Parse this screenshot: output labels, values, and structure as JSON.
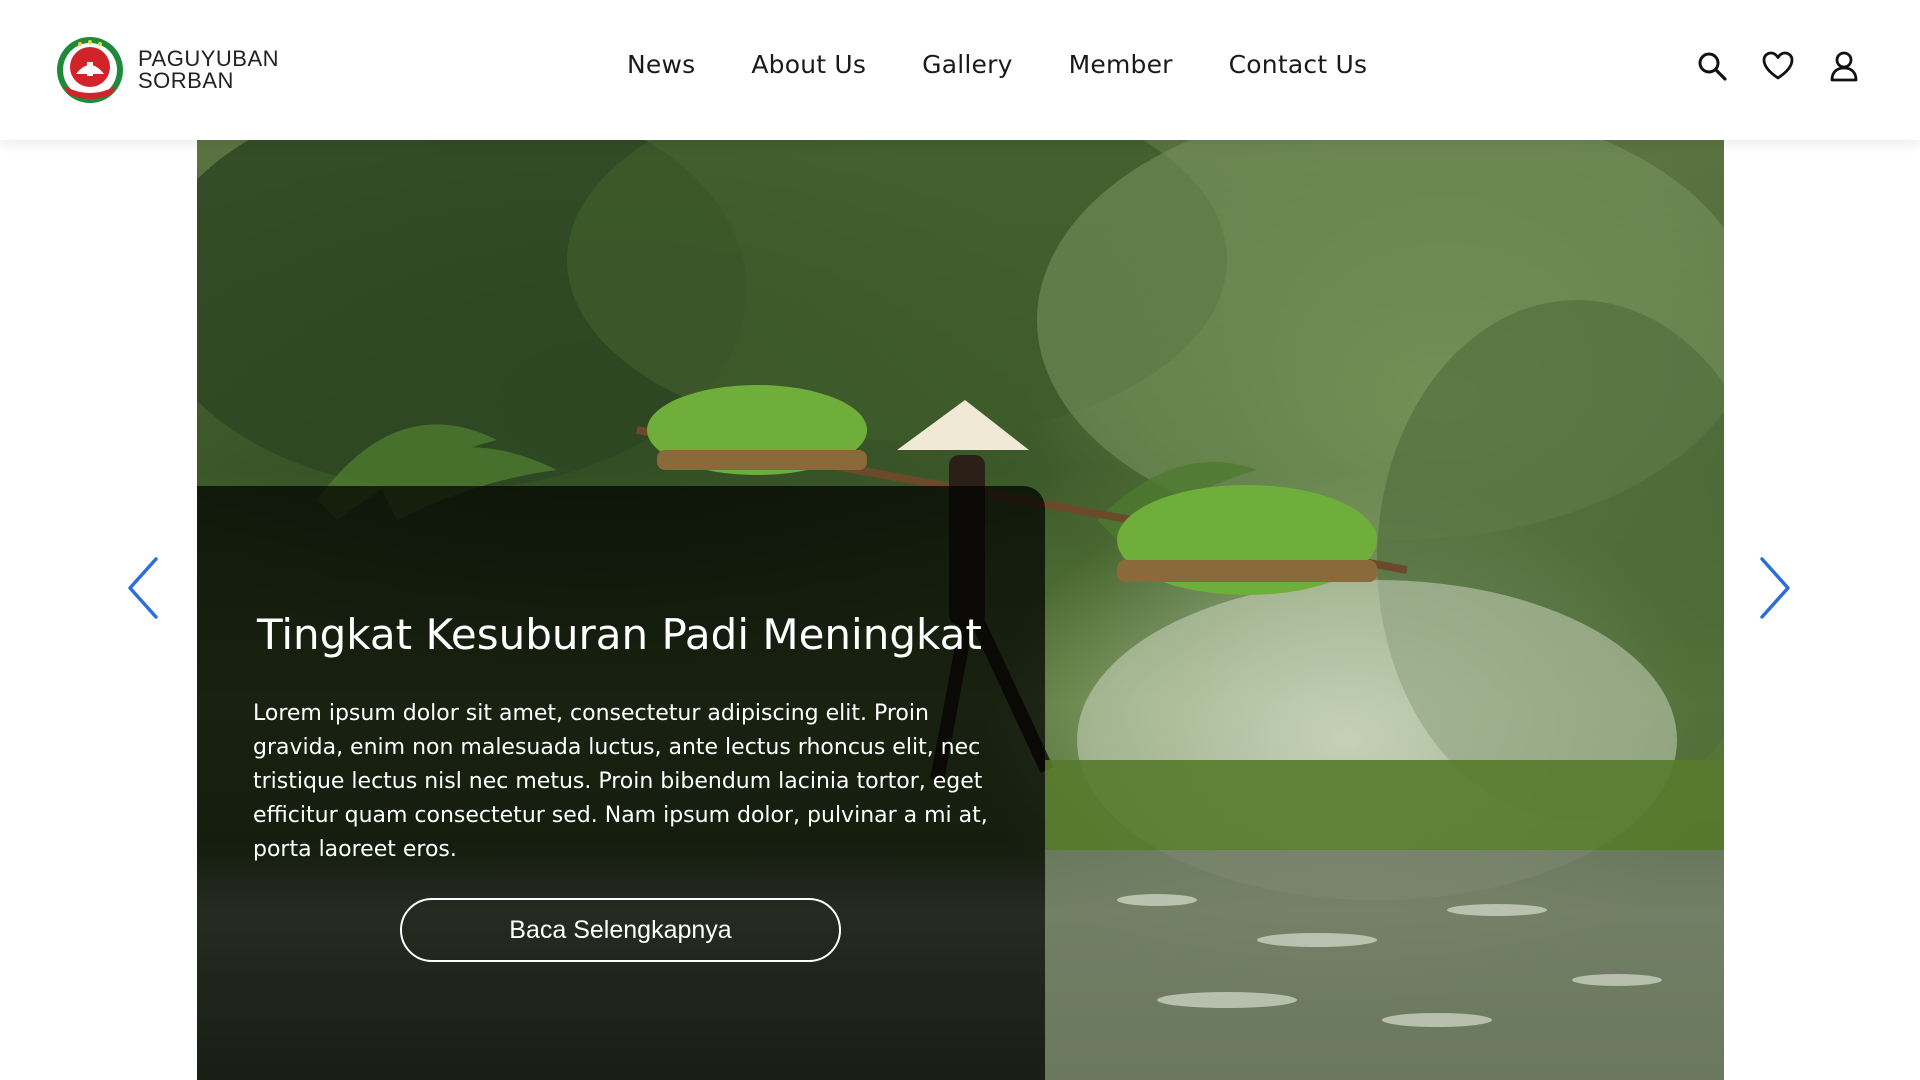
{
  "brand": {
    "line1": "PAGUYUBAN",
    "line2": "SORBAN",
    "logo_icon": "paguyuban-sorban-logo"
  },
  "nav": {
    "items": [
      {
        "label": "News"
      },
      {
        "label": "About Us"
      },
      {
        "label": "Gallery"
      },
      {
        "label": "Member"
      },
      {
        "label": "Contact Us"
      }
    ]
  },
  "header_icons": {
    "search": "search-icon",
    "favorites": "heart-icon",
    "account": "user-icon"
  },
  "hero": {
    "title": "Tingkat Kesuburan Padi Meningkat",
    "description": "Lorem ipsum dolor sit amet, consectetur adipiscing elit. Proin gravida, enim non malesuada luctus, ante lectus rhoncus elit, nec tristique lectus nisl nec metus. Proin bibendum lacinia tortor, eget efficitur quam consectetur sed. Nam ipsum dolor, pulvinar a mi at, porta laoreet eros.",
    "cta_label": "Baca Selengkapnya",
    "prev_icon": "chevron-left-icon",
    "next_icon": "chevron-right-icon"
  },
  "colors": {
    "arrow": "#2a6fdb",
    "overlay": "#000000",
    "logo_green": "#1f8a3a",
    "logo_red": "#d2232a"
  }
}
